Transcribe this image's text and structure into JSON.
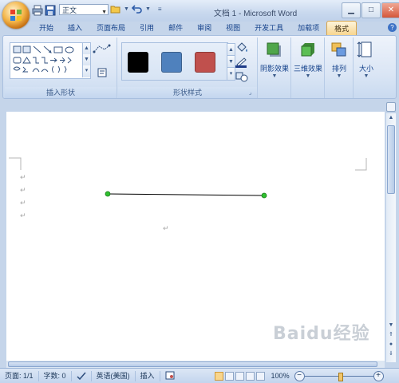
{
  "qat": {
    "style_value": "正文"
  },
  "window": {
    "title": "文档 1 - Microsoft Word"
  },
  "tabs": [
    "开始",
    "插入",
    "页面布局",
    "引用",
    "邮件",
    "审阅",
    "视图",
    "开发工具",
    "加载项",
    "格式"
  ],
  "ribbon": {
    "insert_shapes": {
      "label": "插入形状"
    },
    "shape_styles": {
      "label": "形状样式",
      "swatches": [
        "#000000",
        "#4f81bd",
        "#c0504d"
      ]
    },
    "shadow_effects": {
      "label": "阴影效果"
    },
    "3d_effects": {
      "label": "三维效果"
    },
    "arrange": {
      "label": "排列"
    },
    "size": {
      "label": "大小"
    }
  },
  "document": {
    "paragraph_mark": "↵"
  },
  "status": {
    "page": "页面: 1/1",
    "words": "字数: 0",
    "language": "英语(美国)",
    "mode": "插入",
    "zoom": "100%"
  },
  "watermark": {
    "text": "Baidu经验"
  }
}
